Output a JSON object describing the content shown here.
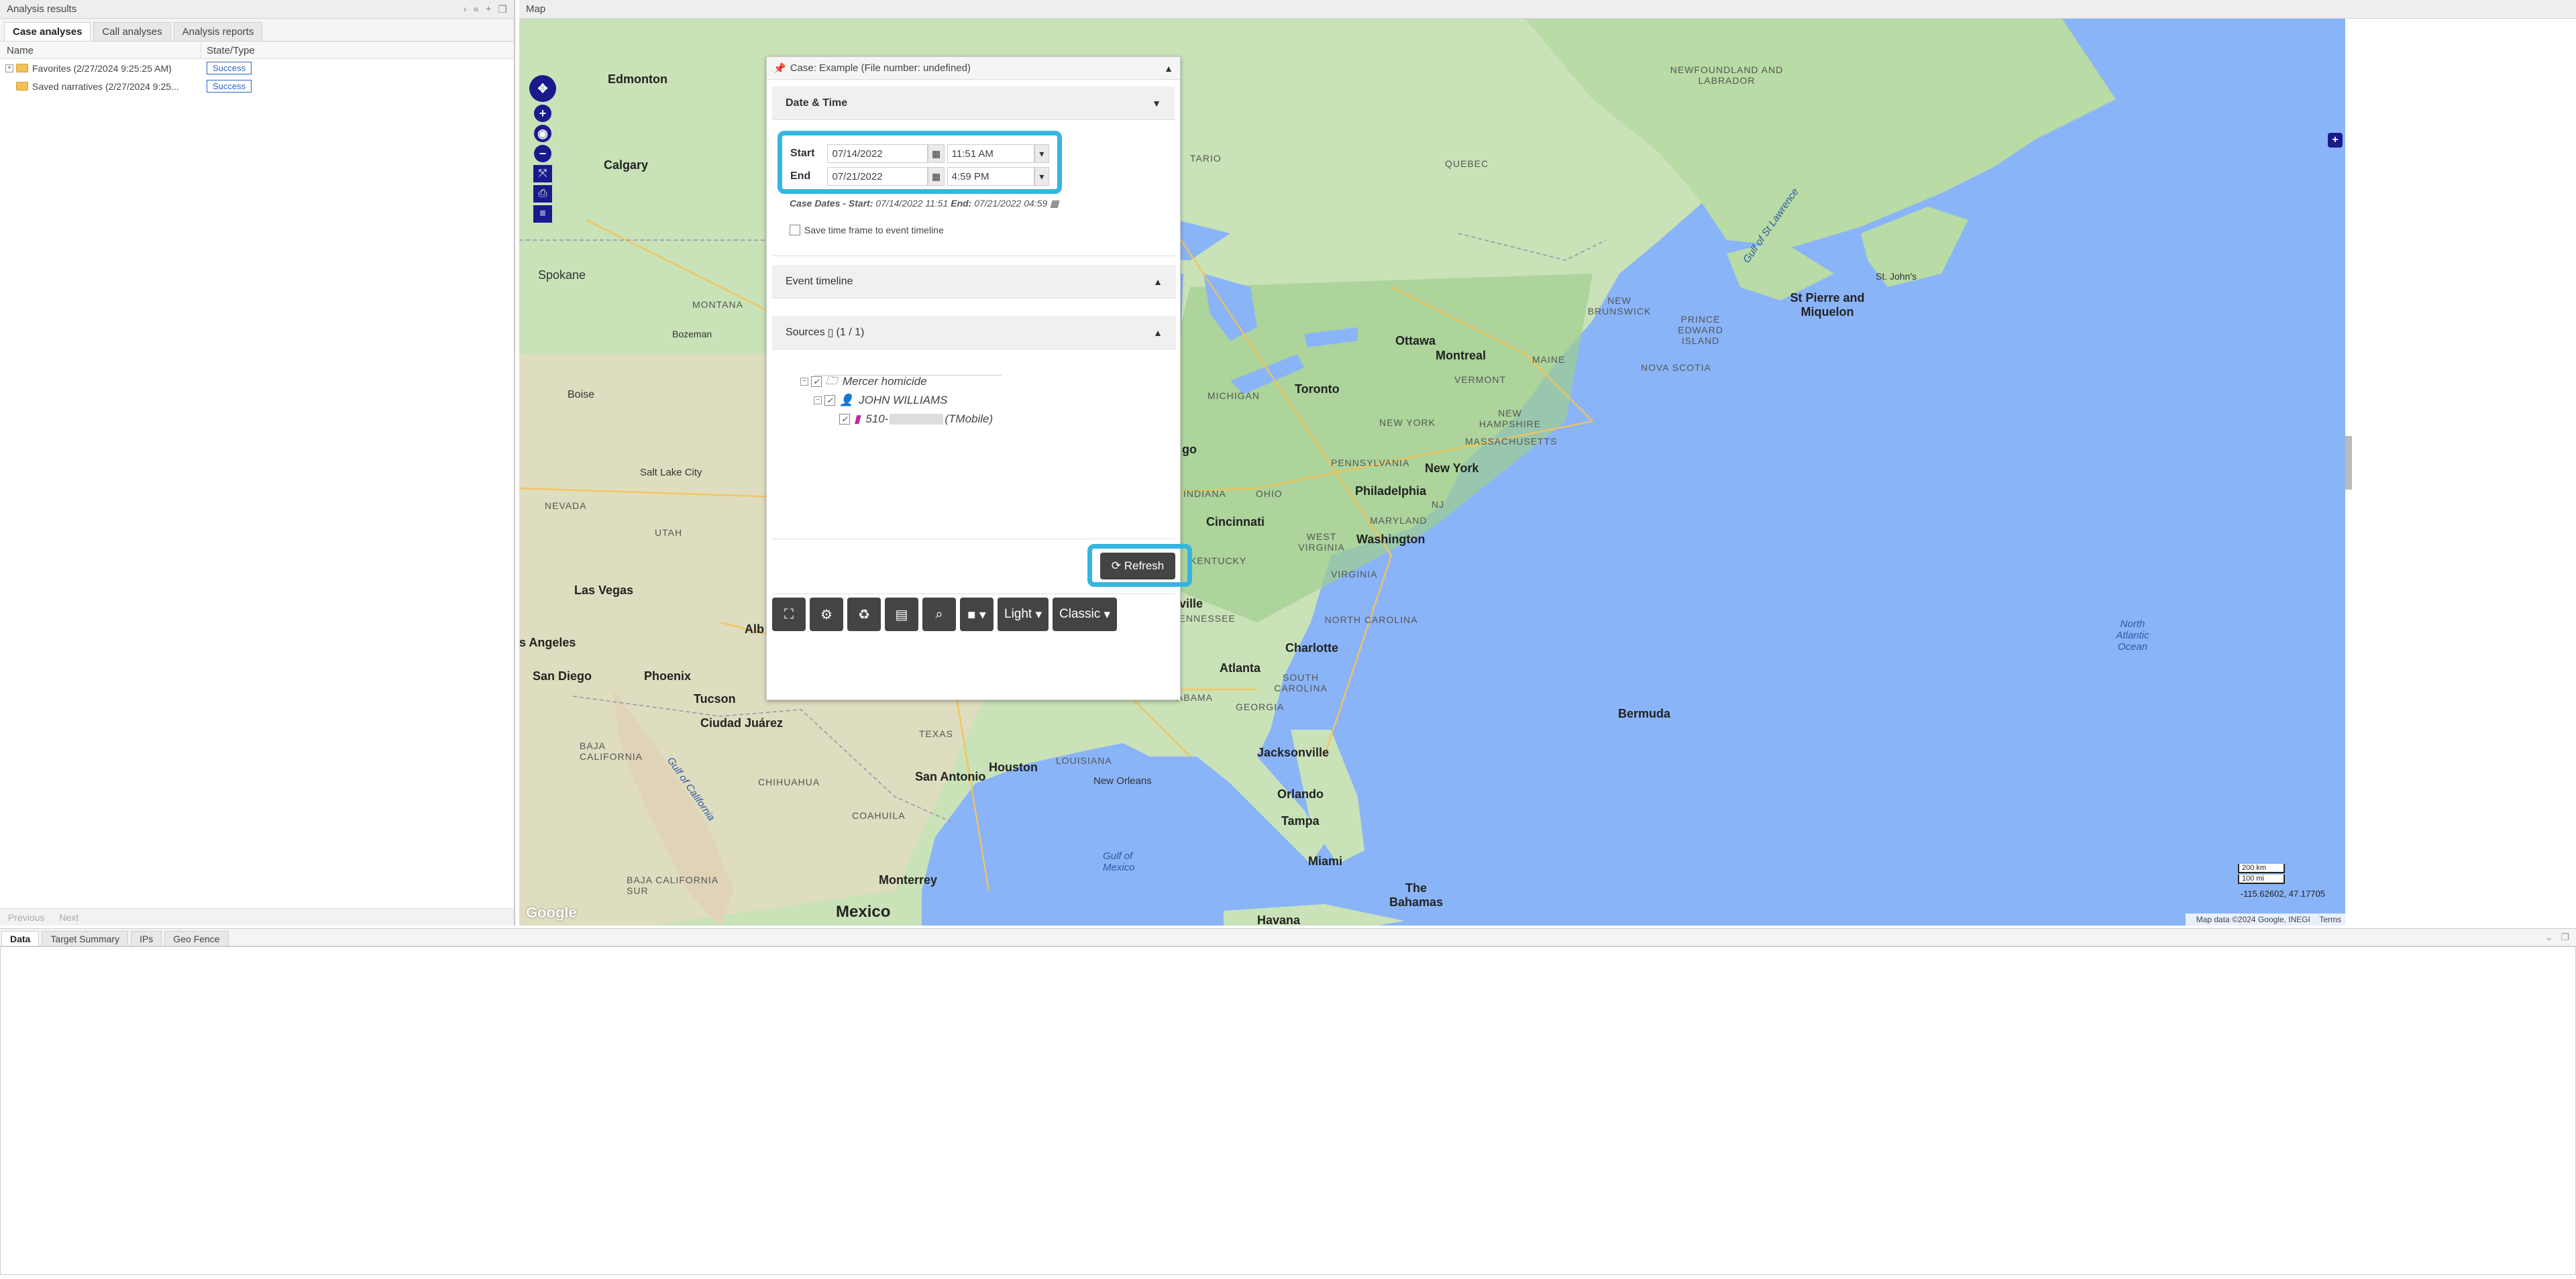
{
  "left": {
    "title": "Analysis results",
    "tabs": [
      "Case analyses",
      "Call analyses",
      "Analysis reports"
    ],
    "columns": [
      "Name",
      "State/Type"
    ],
    "rows": [
      {
        "name": "Favorites (2/27/2024 9:25:25 AM)",
        "status": "Success"
      },
      {
        "name": "Saved narratives (2/27/2024 9:25...",
        "status": "Success"
      }
    ],
    "pager": {
      "prev": "Previous",
      "next": "Next"
    }
  },
  "map": {
    "title": "Map",
    "labels": {
      "edmonton": "Edmonton",
      "calgary": "Calgary",
      "spokane": "Spokane",
      "montana": "MONTANA",
      "bozeman": "Bozeman",
      "boise": "Boise",
      "nevada": "NEVADA",
      "slc": "Salt Lake City",
      "utah": "UTAH",
      "vegas": "Las Vegas",
      "la": "s Angeles",
      "sandiego": "San Diego",
      "phoenix": "Phoenix",
      "tucson": "Tucson",
      "juarez": "Ciudad Juárez",
      "baja": "BAJA CALIFORNIA",
      "bajasur": "BAJA CALIFORNIA SUR",
      "chihuahua": "CHIHUAHUA",
      "coahuila": "COAHUILA",
      "monterrey": "Monterrey",
      "mexico": "Mexico",
      "texas": "TEXAS",
      "sanantonio": "San Antonio",
      "houston": "Houston",
      "neworleans": "New Orleans",
      "louisiana": "LOUISIANA",
      "gulfmexico": "Gulf of Mexico",
      "gulfcal": "Gulf of California",
      "ontario": "ONTARIO",
      "quebec": "QUEBEC",
      "newfoundland": "NEWFOUNDLAND AND LABRADOR",
      "ottawa": "Ottawa",
      "montreal": "Montreal",
      "toronto": "Toronto",
      "michigan": "MICHIGAN",
      "newyork": "NEW YORK",
      "newyorkcity": "New York",
      "philly": "Philadelphia",
      "dc": "Washington",
      "ohio": "OHIO",
      "indiana": "INDIANA",
      "cincinnati": "Cincinnati",
      "westva": "WEST VIRGINIA",
      "virginia": "VIRGINIA",
      "kentucky": "KENTUCKY",
      "tennessee": "TENNESSEE",
      "nashville": "ville",
      "ncarolina": "NORTH CAROLINA",
      "scarolina": "SOUTH CAROLINA",
      "charlotte": "Charlotte",
      "atlanta": "Atlanta",
      "georgia": "GEORGIA",
      "alabama": "ABAMA",
      "jacksonville": "Jacksonville",
      "orlando": "Orlando",
      "tampa": "Tampa",
      "miami": "Miami",
      "bahamas": "The Bahamas",
      "havana": "Havana",
      "bermuda": "Bermuda",
      "atlantic": "North Atlantic Ocean",
      "stpierre": "St Pierre and Miquelon",
      "stjohns": "St. John's",
      "gulfstl": "Gulf of St Lawrence",
      "nb": "NEW BRUNSWICK",
      "pei": "PRINCE EDWARD ISLAND",
      "ns": "NOVA SCOTIA",
      "maine": "MAINE",
      "vermont": "VERMONT",
      "nh": "NEW HAMPSHIRE",
      "mass": "MASSACHUSETTS",
      "pa": "PENNSYLVANIA",
      "nj": "NJ",
      "maryland": "MARYLAND",
      "tario": "TARIO",
      "ago": "go",
      "alb": "Alb"
    },
    "scale": [
      "200 km",
      "100 mi"
    ],
    "coords": "-115.62602, 47.17705",
    "attribution": "Map data ©2024 Google, INEGI",
    "terms": "Terms",
    "google": "Google"
  },
  "dialog": {
    "title": "Case: Example (File number: undefined)",
    "date_time": "Date & Time",
    "start_label": "Start",
    "end_label": "End",
    "start_date": "07/14/2022",
    "start_time": "11:51 AM",
    "end_date": "07/21/2022",
    "end_time": "4:59 PM",
    "case_dates": {
      "prefix": "Case Dates - Start:",
      "start": " 07/14/2022 11:51",
      "end_label": " End:",
      "end": " 07/21/2022 04:59"
    },
    "save_timeframe": "Save time frame to event timeline",
    "event_timeline": "Event timeline",
    "sources": "Sources",
    "sources_count": "(1 / 1)",
    "tree": {
      "case": "Mercer homicide",
      "person": "JOHN WILLIAMS",
      "phone_prefix": "510-",
      "carrier": "(TMobile)"
    },
    "refresh": "Refresh",
    "light": "Light",
    "classic": "Classic"
  },
  "bottom": {
    "tabs": [
      "Data",
      "Target Summary",
      "IPs",
      "Geo Fence"
    ]
  },
  "colors": {
    "highlight": "#35b6e0",
    "water": "#8ab4f8",
    "land": "#bfe0b1",
    "nav": "#1a1a8c"
  }
}
